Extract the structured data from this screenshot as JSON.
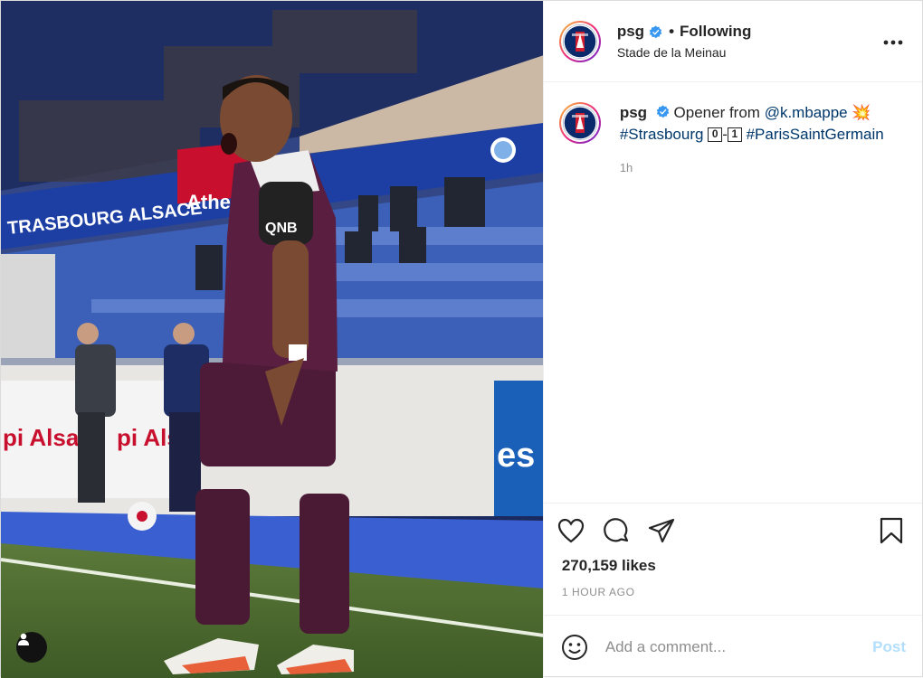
{
  "account": {
    "username": "psg",
    "follow_status": "Following",
    "location": "Stade de la Meinau"
  },
  "caption": {
    "username": "psg",
    "text_start": "Opener from",
    "mention": "@k.mbappe",
    "emoji": "💥",
    "hashtag1": "#Strasbourg",
    "score_home": "0",
    "score_sep": "-",
    "score_away": "1",
    "hashtag2": "#ParisSaintGermain",
    "time": "1h"
  },
  "media": {
    "ad_left": "TRASBOURG ALSACE",
    "ad_mid": "Athen",
    "ad_bottom_left": "pi Alsace",
    "ad_bottom_mid": "pi Als",
    "ad_right": "es",
    "shirt_sponsor": "QNB"
  },
  "stats": {
    "likes": "270,159 likes",
    "posted_ago": "1 HOUR AGO"
  },
  "comment": {
    "placeholder": "Add a comment...",
    "post_label": "Post"
  },
  "colors": {
    "accent": "#0095f6",
    "post_disabled": "#b2dffc",
    "psg_navy": "#0b2a6b",
    "psg_red": "#d01c2f"
  },
  "icons": [
    "verified-icon",
    "more-options-icon",
    "heart-icon",
    "comment-icon",
    "share-icon",
    "bookmark-icon",
    "emoji-icon",
    "user-tag-icon"
  ]
}
